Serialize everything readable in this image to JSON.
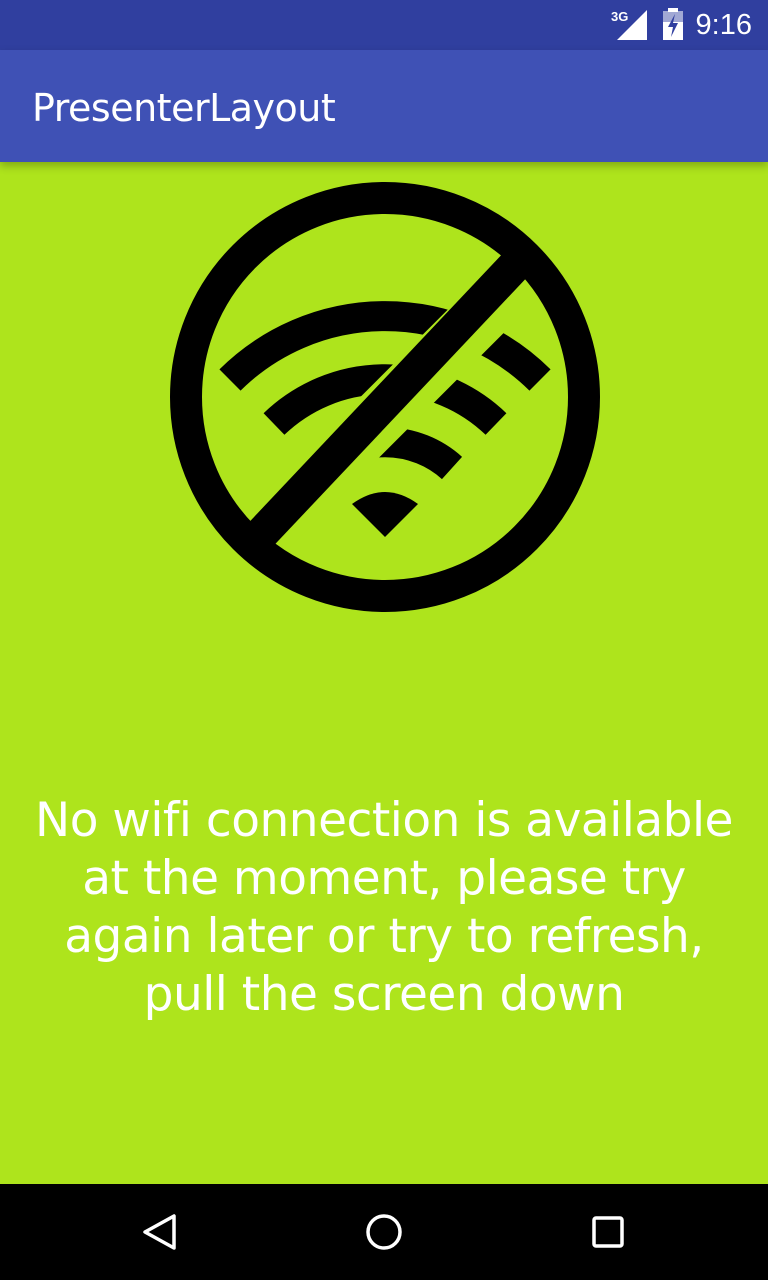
{
  "status_bar": {
    "network": "3G",
    "time": "9:16",
    "color": "#303f9f"
  },
  "app_bar": {
    "title": "PresenterLayout",
    "color": "#3f51b5"
  },
  "main": {
    "background": "#aee41c",
    "icon": "no-wifi-icon",
    "message": "No wifi connection is available at the moment, please try again later or try to refresh, pull the screen down"
  },
  "nav_bar": {
    "buttons": [
      "back-icon",
      "home-icon",
      "recents-icon"
    ]
  }
}
